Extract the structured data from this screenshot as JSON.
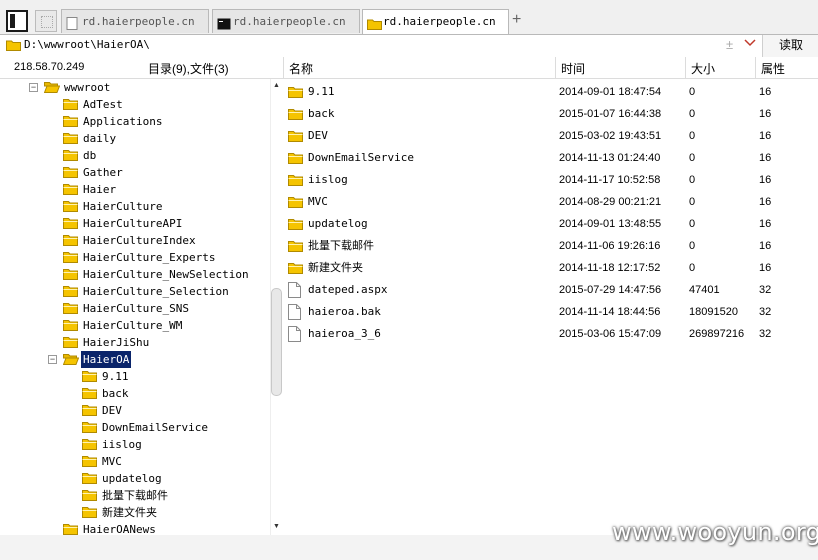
{
  "tabs": [
    {
      "label": "rd.haierpeople.cn",
      "icon": "page-icon",
      "active": false
    },
    {
      "label": "rd.haierpeople.cn",
      "icon": "terminal-icon",
      "active": false
    },
    {
      "label": "rd.haierpeople.cn",
      "icon": "folder-icon",
      "active": true
    }
  ],
  "tab_add_label": "+",
  "address": {
    "path": "D:\\wwwroot\\HaierOA\\",
    "read_label": "读取",
    "plus": "±"
  },
  "info": {
    "ip": "218.58.70.249",
    "dir_count": "目录(9),文件(3)"
  },
  "columns": {
    "name": "名称",
    "time": "时间",
    "size": "大小",
    "attr": "属性"
  },
  "tree": {
    "root": "wwwroot",
    "children": [
      "AdTest",
      "Applications",
      "daily",
      "db",
      "Gather",
      "Haier",
      "HaierCulture",
      "HaierCultureAPI",
      "HaierCultureIndex",
      "HaierCulture_Experts",
      "HaierCulture_NewSelection",
      "HaierCulture_Selection",
      "HaierCulture_SNS",
      "HaierCulture_WM",
      "HaierJiShu"
    ],
    "selected": "HaierOA",
    "selected_children": [
      "9.11",
      "back",
      "DEV",
      "DownEmailService",
      "iislog",
      "MVC",
      "updatelog",
      "批量下载邮件",
      "新建文件夹"
    ],
    "after": [
      "HaierOANews"
    ]
  },
  "files": [
    {
      "name": "9.11",
      "time": "2014-09-01 18:47:54",
      "size": "0",
      "attr": "16",
      "type": "folder"
    },
    {
      "name": "back",
      "time": "2015-01-07 16:44:38",
      "size": "0",
      "attr": "16",
      "type": "folder"
    },
    {
      "name": "DEV",
      "time": "2015-03-02 19:43:51",
      "size": "0",
      "attr": "16",
      "type": "folder"
    },
    {
      "name": "DownEmailService",
      "time": "2014-11-13 01:24:40",
      "size": "0",
      "attr": "16",
      "type": "folder"
    },
    {
      "name": "iislog",
      "time": "2014-11-17 10:52:58",
      "size": "0",
      "attr": "16",
      "type": "folder"
    },
    {
      "name": "MVC",
      "time": "2014-08-29 00:21:21",
      "size": "0",
      "attr": "16",
      "type": "folder"
    },
    {
      "name": "updatelog",
      "time": "2014-09-01 13:48:55",
      "size": "0",
      "attr": "16",
      "type": "folder"
    },
    {
      "name": "批量下载邮件",
      "time": "2014-11-06 19:26:16",
      "size": "0",
      "attr": "16",
      "type": "folder"
    },
    {
      "name": "新建文件夹",
      "time": "2014-11-18 12:17:52",
      "size": "0",
      "attr": "16",
      "type": "folder"
    },
    {
      "name": "dateped.aspx",
      "time": "2015-07-29 14:47:56",
      "size": "47401",
      "attr": "32",
      "type": "file"
    },
    {
      "name": "haieroa.bak",
      "time": "2014-11-14 18:44:56",
      "size": "18091520",
      "attr": "32",
      "type": "file"
    },
    {
      "name": "haieroa_3_6",
      "time": "2015-03-06 15:47:09",
      "size": "269897216",
      "attr": "32",
      "type": "file"
    }
  ],
  "watermark": "www.wooyun.org",
  "colors": {
    "folder": "#f5c400",
    "selection": "#0a246a"
  }
}
